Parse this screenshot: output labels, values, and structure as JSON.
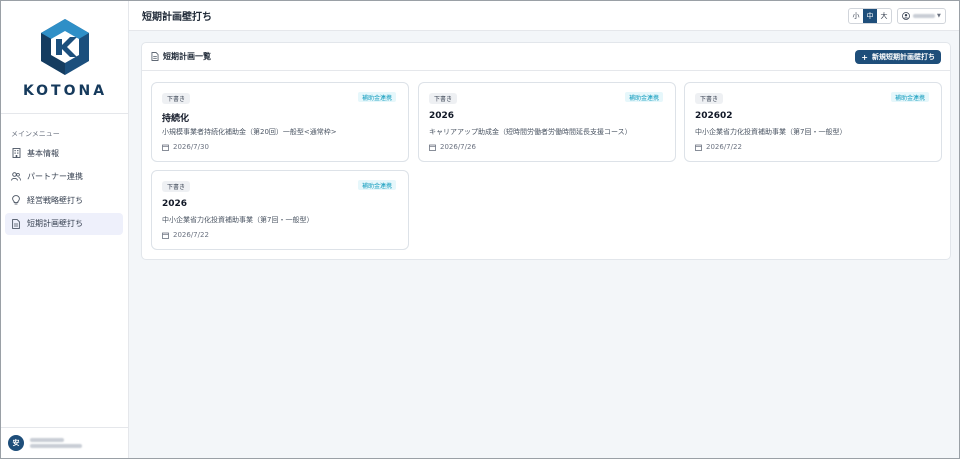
{
  "sidebar": {
    "brand": "KOTONA",
    "menu_title": "メインメニュー",
    "items": [
      {
        "label": "基本情報",
        "icon": "building-icon",
        "active": false
      },
      {
        "label": "パートナー連携",
        "icon": "users-icon",
        "active": false
      },
      {
        "label": "経営戦略壁打ち",
        "icon": "lightbulb-icon",
        "active": false
      },
      {
        "label": "短期計画壁打ち",
        "icon": "document-icon",
        "active": true
      }
    ],
    "footer": {
      "avatar_initial": "安"
    }
  },
  "header": {
    "title": "短期計画壁打ち",
    "font_sizes": [
      "小",
      "中",
      "大"
    ],
    "font_size_selected": "中"
  },
  "panel": {
    "title": "短期計画一覧",
    "new_button": "新規短期計画壁打ち",
    "cards": [
      {
        "badge": "下書き",
        "tag": "補助金連携",
        "title": "持続化",
        "description": "小規模事業者持続化補助金（第20回）一般型<通常枠>",
        "date": "2026/7/30"
      },
      {
        "badge": "下書き",
        "tag": "補助金連携",
        "title": "2026",
        "description": "キャリアアップ助成金（短時間労働者労働時間延長支援コース）",
        "date": "2026/7/26"
      },
      {
        "badge": "下書き",
        "tag": "補助金連携",
        "title": "202602",
        "description": "中小企業省力化投資補助事業（第7回・一般型）",
        "date": "2026/7/22"
      },
      {
        "badge": "下書き",
        "tag": "補助金連携",
        "title": "2026",
        "description": "中小企業省力化投資補助事業（第7回・一般型）",
        "date": "2026/7/22"
      }
    ]
  },
  "colors": {
    "primary": "#1e4e7a",
    "tag_text": "#0f9bbd",
    "tag_bg": "#e6f7fb",
    "active_nav": "#eef0fb"
  }
}
